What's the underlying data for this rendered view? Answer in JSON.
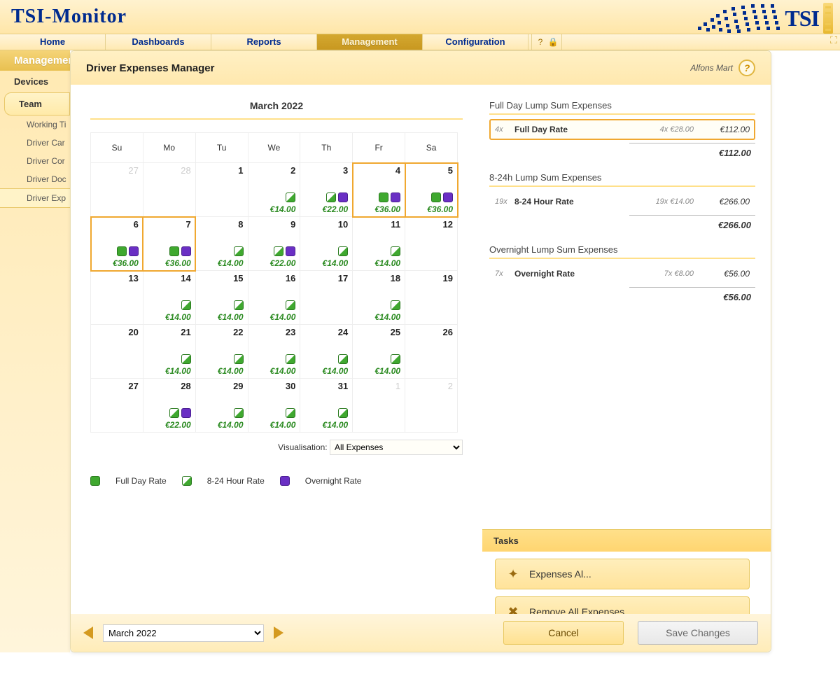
{
  "app": {
    "title": "TSI-Monitor",
    "logo_text": "TSI"
  },
  "topnav": {
    "items": [
      "Home",
      "Dashboards",
      "Reports",
      "Management",
      "Configuration"
    ],
    "active_index": 3
  },
  "section_title": "Management",
  "sidebar": {
    "items": [
      "Devices",
      "Team"
    ],
    "active_index": 1,
    "sub_items": [
      "Working Ti",
      "Driver Car",
      "Driver Cor",
      "Driver Doc",
      "Driver Exp"
    ],
    "sub_selected_index": 4
  },
  "panel": {
    "title": "Driver Expenses Manager",
    "user": "Alfons Mart"
  },
  "calendar": {
    "title": "March 2022",
    "weekdays": [
      "Su",
      "Mo",
      "Tu",
      "We",
      "Th",
      "Fr",
      "Sa"
    ],
    "visualisation_label": "Visualisation:",
    "visualisation_value": "All Expenses",
    "legend": {
      "full": "Full Day Rate",
      "part": "8-24 Hour Rate",
      "night": "Overnight Rate"
    },
    "cells": [
      {
        "d": "27",
        "out": true
      },
      {
        "d": "28",
        "out": true
      },
      {
        "d": "1"
      },
      {
        "d": "2",
        "marks": [
          "part"
        ],
        "amt": "€14.00"
      },
      {
        "d": "3",
        "marks": [
          "part",
          "night"
        ],
        "amt": "€22.00"
      },
      {
        "d": "4",
        "marks": [
          "full",
          "night"
        ],
        "amt": "€36.00",
        "hl": true
      },
      {
        "d": "5",
        "marks": [
          "full",
          "night"
        ],
        "amt": "€36.00",
        "hl": true
      },
      {
        "d": "6",
        "marks": [
          "full",
          "night"
        ],
        "amt": "€36.00",
        "hl": true
      },
      {
        "d": "7",
        "marks": [
          "full",
          "night"
        ],
        "amt": "€36.00",
        "hl": true
      },
      {
        "d": "8",
        "marks": [
          "part"
        ],
        "amt": "€14.00"
      },
      {
        "d": "9",
        "marks": [
          "part",
          "night"
        ],
        "amt": "€22.00"
      },
      {
        "d": "10",
        "marks": [
          "part"
        ],
        "amt": "€14.00"
      },
      {
        "d": "11",
        "marks": [
          "part"
        ],
        "amt": "€14.00"
      },
      {
        "d": "12"
      },
      {
        "d": "13"
      },
      {
        "d": "14",
        "marks": [
          "part"
        ],
        "amt": "€14.00"
      },
      {
        "d": "15",
        "marks": [
          "part"
        ],
        "amt": "€14.00"
      },
      {
        "d": "16",
        "marks": [
          "part"
        ],
        "amt": "€14.00"
      },
      {
        "d": "17"
      },
      {
        "d": "18",
        "marks": [
          "part"
        ],
        "amt": "€14.00"
      },
      {
        "d": "19"
      },
      {
        "d": "20"
      },
      {
        "d": "21",
        "marks": [
          "part"
        ],
        "amt": "€14.00"
      },
      {
        "d": "22",
        "marks": [
          "part"
        ],
        "amt": "€14.00"
      },
      {
        "d": "23",
        "marks": [
          "part"
        ],
        "amt": "€14.00"
      },
      {
        "d": "24",
        "marks": [
          "part"
        ],
        "amt": "€14.00"
      },
      {
        "d": "25",
        "marks": [
          "part"
        ],
        "amt": "€14.00"
      },
      {
        "d": "26"
      },
      {
        "d": "27"
      },
      {
        "d": "28",
        "marks": [
          "part",
          "night"
        ],
        "amt": "€22.00"
      },
      {
        "d": "29",
        "marks": [
          "part"
        ],
        "amt": "€14.00"
      },
      {
        "d": "30",
        "marks": [
          "part"
        ],
        "amt": "€14.00"
      },
      {
        "d": "31",
        "marks": [
          "part"
        ],
        "amt": "€14.00"
      },
      {
        "d": "1",
        "out": true
      },
      {
        "d": "2",
        "out": true
      }
    ]
  },
  "summary": {
    "sections": [
      {
        "title": "Full Day Lump Sum Expenses",
        "count": "4x",
        "label": "Full Day Rate",
        "rate": "4x €28.00",
        "total": "€112.00",
        "sum": "€112.00",
        "hl": true
      },
      {
        "title": "8-24h Lump Sum Expenses",
        "count": "19x",
        "label": "8-24 Hour Rate",
        "rate": "19x €14.00",
        "total": "€266.00",
        "sum": "€266.00"
      },
      {
        "title": "Overnight Lump Sum Expenses",
        "count": "7x",
        "label": "Overnight Rate",
        "rate": "7x €8.00",
        "total": "€56.00",
        "sum": "€56.00"
      }
    ]
  },
  "tasks": {
    "heading": "Tasks",
    "items": [
      "Expenses Al...",
      "Remove All Expenses..."
    ]
  },
  "footer": {
    "month_value": "March 2022",
    "cancel": "Cancel",
    "save": "Save Changes"
  }
}
